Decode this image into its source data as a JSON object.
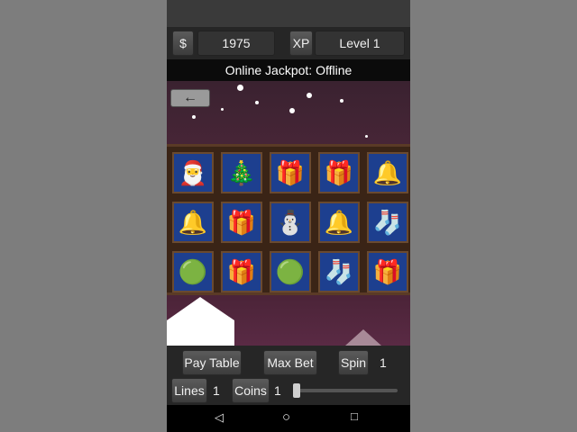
{
  "topbar": {
    "currency_label": "$",
    "balance": "1975",
    "xp_label": "XP",
    "level": "Level 1"
  },
  "jackpot_text": "Online Jackpot: Offline",
  "back_arrow": "←",
  "reels": [
    [
      "santa-hat",
      "christmas-tree",
      "gift-box-blue",
      "gift-box-yellow",
      "bells"
    ],
    [
      "bells",
      "gift-box-blue",
      "snowman",
      "bells",
      "stocking"
    ],
    [
      "ornament-green",
      "gift-box-yellow",
      "ornament-green",
      "stocking",
      "gift-box-blue"
    ]
  ],
  "symbol_glyphs": {
    "santa-hat": "🎅",
    "christmas-tree": "🎄",
    "gift-box-blue": "🎁",
    "gift-box-yellow": "🎁",
    "bells": "🔔",
    "snowman": "⛄",
    "stocking": "🧦",
    "ornament-green": "🟢"
  },
  "controls": {
    "pay_table": "Pay Table",
    "max_bet": "Max Bet",
    "spin": "Spin",
    "spin_value": "1",
    "lines": "Lines",
    "lines_value": "1",
    "coins": "Coins",
    "coins_value": "1"
  },
  "coin_slider_level": 0,
  "nav": {
    "back": "◁",
    "home": "○",
    "recents": "□"
  }
}
